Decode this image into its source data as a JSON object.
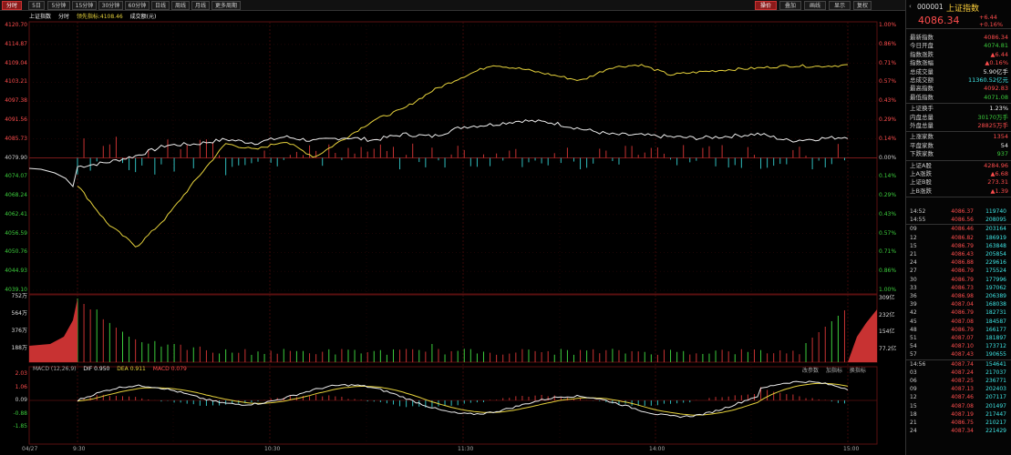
{
  "toolbar": {
    "tabs": [
      "分时",
      "5日",
      "5分钟",
      "15分钟",
      "30分钟",
      "60分钟",
      "日线",
      "周线",
      "月线",
      "更多周期"
    ],
    "right_buttons": [
      "操价",
      "叠加",
      "画线",
      "显示",
      "复权"
    ]
  },
  "info": {
    "index_name": "上证指数",
    "mode": "分时",
    "leader_label": "领先指标:4108.46",
    "turnover_label": "成交额(元)"
  },
  "price_axis_left": [
    "4120.70",
    "4114.87",
    "4109.04",
    "4103.21",
    "4097.38",
    "4091.56",
    "4085.73",
    "4079.90",
    "4074.07",
    "4068.24",
    "4062.41",
    "4056.59",
    "4050.76",
    "4044.93",
    "4039.10"
  ],
  "price_axis_right": [
    "1.00%",
    "0.86%",
    "0.71%",
    "0.57%",
    "0.43%",
    "0.29%",
    "0.14%",
    "0.00%",
    "0.14%",
    "0.29%",
    "0.43%",
    "0.57%",
    "0.71%",
    "0.86%",
    "1.00%"
  ],
  "volume_axis_left": [
    "752万",
    "564万",
    "376万",
    "188万"
  ],
  "volume_axis_right": [
    "309亿",
    "232亿",
    "154亿",
    "77.2亿"
  ],
  "macd": {
    "label": "MACD (12,26,9)",
    "dif": "DIF 0.950",
    "dea": "DEA 0.911",
    "macd": "MACD 0.079",
    "axis": [
      "2.03",
      "1.06",
      "0.09",
      "-0.88",
      "-1.85"
    ],
    "buttons": [
      "改参数",
      "加指标",
      "换指标"
    ]
  },
  "time_axis": [
    "04/27",
    "9:30",
    "10:30",
    "11:30",
    "14:00",
    "15:00"
  ],
  "sidebar": {
    "code": "000001",
    "name": "上证指数",
    "price": "4086.34",
    "change": "+6.44",
    "change_pct": "+0.16%",
    "stats": [
      {
        "k": "最新指数",
        "v": "4086.34",
        "c": "red"
      },
      {
        "k": "今日开盘",
        "v": "4074.81",
        "c": "green"
      },
      {
        "k": "指数涨跌",
        "v": "▲6.44",
        "c": "red"
      },
      {
        "k": "指数涨幅",
        "v": "▲0.16%",
        "c": "red"
      },
      {
        "k": "总成交量",
        "v": "5.90亿手",
        "c": "white"
      },
      {
        "k": "总成交额",
        "v": "11360.52亿元",
        "c": "cyan"
      },
      {
        "k": "最高指数",
        "v": "4092.83",
        "c": "red"
      },
      {
        "k": "最低指数",
        "v": "4071.08",
        "c": "green"
      }
    ],
    "stats2": [
      {
        "k": "上证换手",
        "v": "1.23%",
        "c": "white"
      },
      {
        "k": "内盘总量",
        "v": "30170万手",
        "c": "green"
      },
      {
        "k": "外盘总量",
        "v": "28825万手",
        "c": "red"
      }
    ],
    "stats3": [
      {
        "k": "上涨家数",
        "v": "1354",
        "c": "red"
      },
      {
        "k": "平盘家数",
        "v": "54",
        "c": "white"
      },
      {
        "k": "下跌家数",
        "v": "937",
        "c": "green"
      }
    ],
    "stats4": [
      {
        "k": "上证A股",
        "v": "4284.96",
        "c": "red"
      },
      {
        "k": "上A涨跌",
        "v": "▲6.68",
        "c": "red"
      },
      {
        "k": "上证B股",
        "v": "273.31",
        "c": "red"
      },
      {
        "k": "上B涨跌",
        "v": "▲1.39",
        "c": "red"
      }
    ],
    "ticks": [
      {
        "t": "14:52",
        "p": "4086.37",
        "v": "119740"
      },
      {
        "t": "14:55",
        "p": "4086.56",
        "v": "208095"
      },
      {
        "t": "09",
        "p": "4086.46",
        "v": "203164"
      },
      {
        "t": "12",
        "p": "4086.82",
        "v": "186919"
      },
      {
        "t": "15",
        "p": "4086.79",
        "v": "163848"
      },
      {
        "t": "21",
        "p": "4086.43",
        "v": "205854"
      },
      {
        "t": "24",
        "p": "4086.88",
        "v": "229616"
      },
      {
        "t": "27",
        "p": "4086.79",
        "v": "175524"
      },
      {
        "t": "30",
        "p": "4086.79",
        "v": "177996"
      },
      {
        "t": "33",
        "p": "4086.73",
        "v": "197062"
      },
      {
        "t": "36",
        "p": "4086.98",
        "v": "206389"
      },
      {
        "t": "39",
        "p": "4087.04",
        "v": "168038"
      },
      {
        "t": "42",
        "p": "4086.79",
        "v": "182731"
      },
      {
        "t": "45",
        "p": "4087.08",
        "v": "184587"
      },
      {
        "t": "48",
        "p": "4086.79",
        "v": "166177"
      },
      {
        "t": "51",
        "p": "4087.07",
        "v": "181897"
      },
      {
        "t": "54",
        "p": "4087.10",
        "v": "173712"
      },
      {
        "t": "57",
        "p": "4087.43",
        "v": "190655"
      },
      {
        "t": "14:56",
        "p": "4087.74",
        "v": "154641"
      },
      {
        "t": "03",
        "p": "4087.24",
        "v": "217037"
      },
      {
        "t": "06",
        "p": "4087.25",
        "v": "236771"
      },
      {
        "t": "09",
        "p": "4087.13",
        "v": "202403"
      },
      {
        "t": "12",
        "p": "4087.46",
        "v": "207117"
      },
      {
        "t": "15",
        "p": "4087.08",
        "v": "201497"
      },
      {
        "t": "18",
        "p": "4087.19",
        "v": "217447"
      },
      {
        "t": "21",
        "p": "4086.75",
        "v": "210217"
      },
      {
        "t": "24",
        "p": "4087.34",
        "v": "221429"
      }
    ]
  },
  "colors": {
    "up": "#ff4d4d",
    "down": "#3ccc3c",
    "cyan": "#3fe6e6",
    "yellow": "#e6d23c",
    "white": "#eeeeee"
  },
  "chart_data": {
    "type": "line",
    "series": [
      {
        "name": "上证指数",
        "values": [
          4077.2,
          4078.5,
          4080.6,
          4083.8,
          4084.2,
          4085.6,
          4084.5,
          4086.4,
          4085.1,
          4086.2,
          4085.4,
          4087.2,
          4086.5,
          4089.5,
          4090.2,
          4091.4,
          4090.8,
          4088.8,
          4087.1,
          4086.9,
          4086.4,
          4086.0,
          4086.6,
          4087.3,
          4085.2,
          4085.8,
          4086.4
        ]
      },
      {
        "name": "领先指标",
        "values": [
          4071.5,
          4059.8,
          4052.5,
          4061.6,
          4073.2,
          4084.3,
          4082.4,
          4085.1,
          4080.1,
          4085.8,
          4091.5,
          4095.0,
          4100.7,
          4104.9,
          4108.6,
          4107.3,
          4105.5,
          4103.7,
          4107.8,
          4108.6,
          4105.5,
          4106.4,
          4107.1,
          4107.6,
          4108.3,
          4108.1,
          4108.5
        ]
      }
    ],
    "ylim": [
      4039.1,
      4120.7
    ]
  }
}
